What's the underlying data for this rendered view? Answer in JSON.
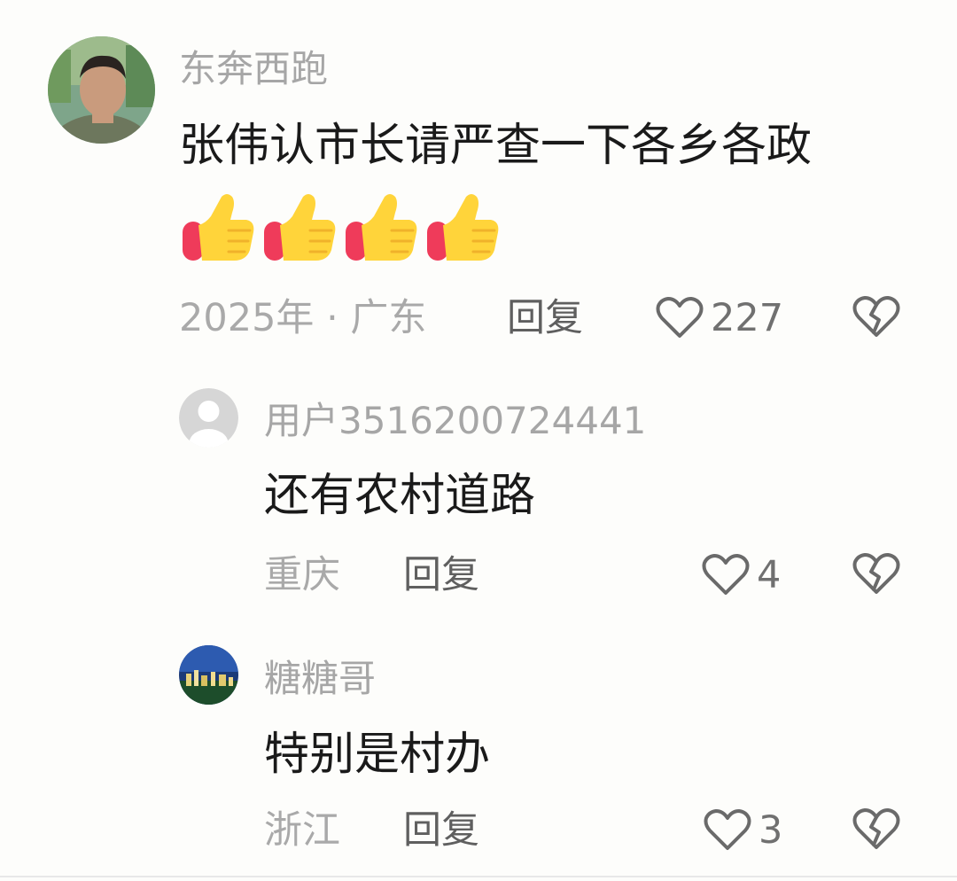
{
  "comments": [
    {
      "username": "东奔西跑",
      "text": "张伟认市长请严查一下各乡各政",
      "emoji": [
        "👍",
        "👍",
        "👍",
        "👍"
      ],
      "meta": "2025年 · 广东",
      "reply_label": "回复",
      "like_count": "227"
    },
    {
      "username": "用户3516200724441",
      "text": "还有农村道路",
      "meta": "重庆",
      "reply_label": "回复",
      "like_count": "4"
    },
    {
      "username": "糖糖哥",
      "text": "特别是村办",
      "meta": "浙江",
      "reply_label": "回复",
      "like_count": "3"
    }
  ]
}
